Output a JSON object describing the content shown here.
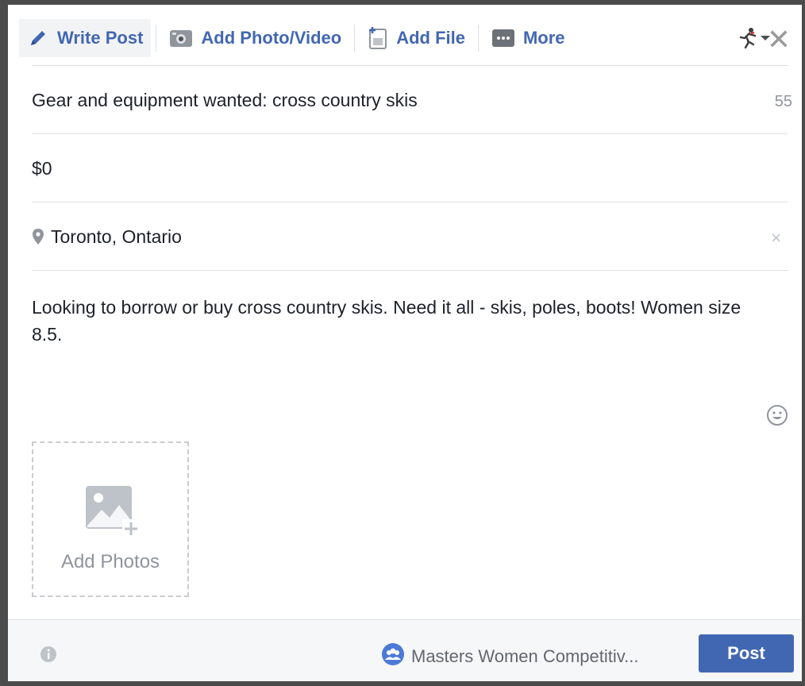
{
  "composer": {
    "tabs": [
      {
        "label": "Write Post",
        "icon": "pencil-icon",
        "active": true
      },
      {
        "label": "Add Photo/Video",
        "icon": "camera-icon"
      },
      {
        "label": "Add File",
        "icon": "file-icon"
      },
      {
        "label": "More",
        "icon": "more-icon"
      }
    ],
    "title_field": {
      "value": "Gear and equipment wanted: cross country skis",
      "char_count": "55"
    },
    "price_field": {
      "value": "$0"
    },
    "location_field": {
      "value": "Toronto, Ontario"
    },
    "description": "Looking to borrow or buy cross country skis. Need it all - skis, poles, boots! Women size 8.5.",
    "add_photos_label": "Add Photos"
  },
  "footer": {
    "group_name": "Masters Women Competitiv...",
    "post_label": "Post"
  },
  "colors": {
    "accent": "#4267b2",
    "muted": "#90949c",
    "divider": "#dddfe2"
  }
}
